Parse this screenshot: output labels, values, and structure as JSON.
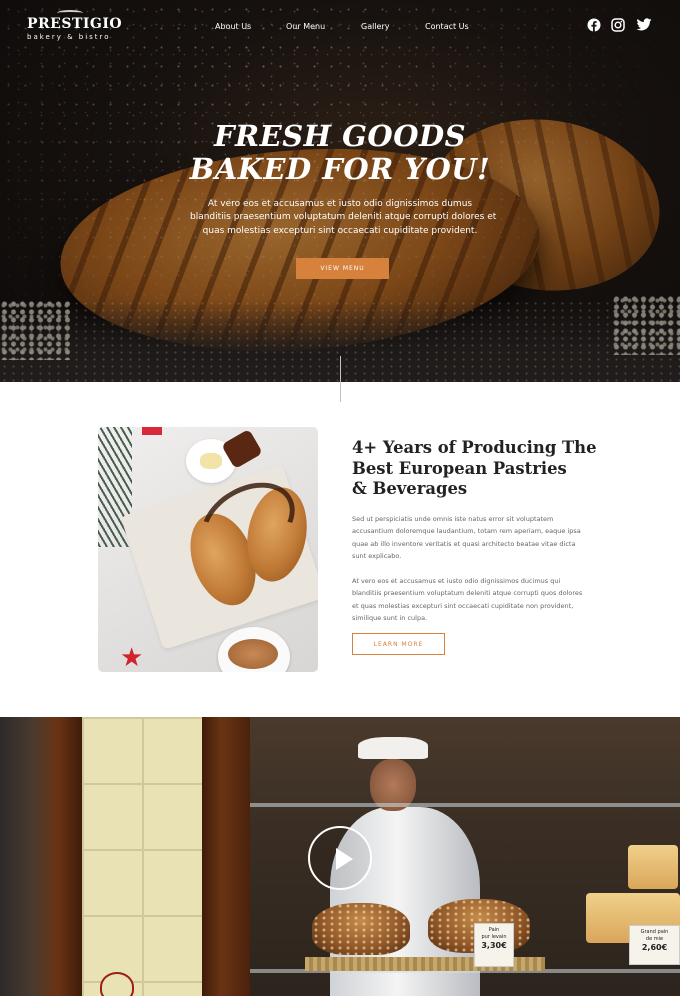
{
  "brand": {
    "name": "PRESTIGIO",
    "tagline": "bakery & bistro"
  },
  "nav": [
    {
      "label": "About Us"
    },
    {
      "label": "Our Menu"
    },
    {
      "label": "Gallery"
    },
    {
      "label": "Contact Us"
    }
  ],
  "social": [
    "facebook-icon",
    "instagram-icon",
    "twitter-icon"
  ],
  "hero": {
    "title_line1": "FRESH GOODS",
    "title_line2": "BAKED FOR YOU!",
    "text_line1": "At vero eos et accusamus et iusto odio dignissimos dumus",
    "text_line2": "blanditiis praesentium voluptatum deleniti atque corrupti dolores et",
    "text_line3": "quas molestias excepturi sint occaecati cupiditate provident.",
    "button": "VIEW MENU"
  },
  "about": {
    "title_line1": "4+ Years of Producing The",
    "title_line2": "Best European Pastries",
    "title_line3": "& Beverages",
    "p1_line1": "Sed ut perspiciatis unde omnis iste natus error sit voluptatem",
    "p1_line2": "accusantium doloremque laudantium, totam rem aperiam, eaque ipsa",
    "p1_line3": "quae ab illo inventore veritatis et quasi architecto beatae vitae dicta",
    "p1_line4": "sunt explicabo.",
    "p2_line1": "At vero eos et accusamus et iusto odio dignissimos ducimus qui",
    "p2_line2": "blanditiis praesentium voluptatum deleniti atque corrupti quos dolores",
    "p2_line3": "et quas molestias excepturi sint occaecati cupiditate non provident,",
    "p2_line4": "similique sunt in culpa.",
    "button": "LEARN MORE"
  },
  "video": {
    "tag1_name": "Pain",
    "tag1_sub": "pur levain",
    "tag1_price": "3,30€",
    "tag2_name": "Grand pain",
    "tag2_sub": "de mie",
    "tag2_price": "2,60€"
  },
  "colors": {
    "accent": "#d6813c",
    "text_dark": "#222222",
    "text_muted": "#666666"
  }
}
